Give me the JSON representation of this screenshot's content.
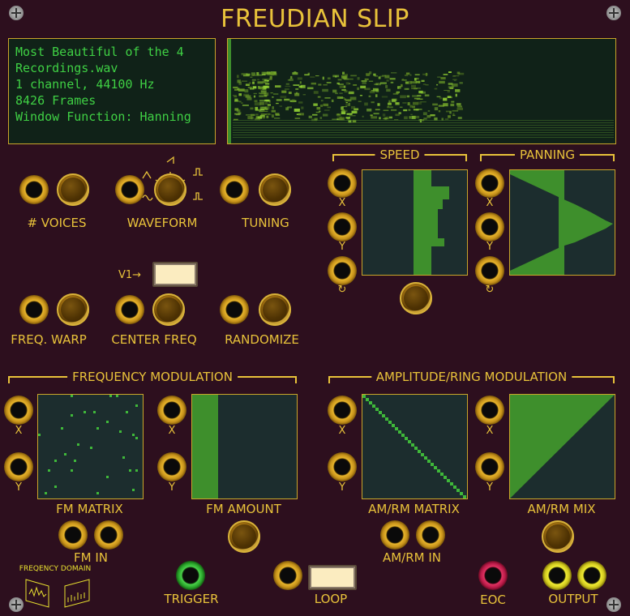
{
  "title": "FREUDIAN SLIP",
  "info_lines": [
    "Most Beautiful of the 4",
    "Recordings.wav",
    "1 channel, 44100 Hz",
    "8426 Frames",
    "Window Function: Hanning"
  ],
  "labels": {
    "voices": "# VOICES",
    "waveform": "WAVEFORM",
    "tuning": "TUNING",
    "v1": "V1→",
    "freq_warp": "FREQ. WARP",
    "center_freq": "CENTER FREQ",
    "randomize": "RANDOMIZE",
    "speed": "SPEED",
    "panning": "PANNING",
    "freq_mod": "FREQUENCY MODULATION",
    "amp_mod": "AMPLITUDE/RING MODULATION",
    "x": "X",
    "y": "Y",
    "loop_symbol": "↻",
    "fm_matrix": "FM MATRIX",
    "fm_amount": "FM AMOUNT",
    "amrm_matrix": "AM/RM MATRIX",
    "amrm_mix": "AM/RM MIX",
    "fm_in": "FM IN",
    "amrm_in": "AM/RM IN",
    "trigger": "TRIGGER",
    "loop": "LOOP",
    "eoc": "EOC",
    "output": "OUTPUT",
    "freq_domain_logo": "FREQENCY DOMAIN"
  },
  "colors": {
    "accent": "#e8c23a",
    "screen_text": "#3fd044",
    "matrix_fill": "#3e8f2c",
    "background": "#2d0f1e"
  }
}
